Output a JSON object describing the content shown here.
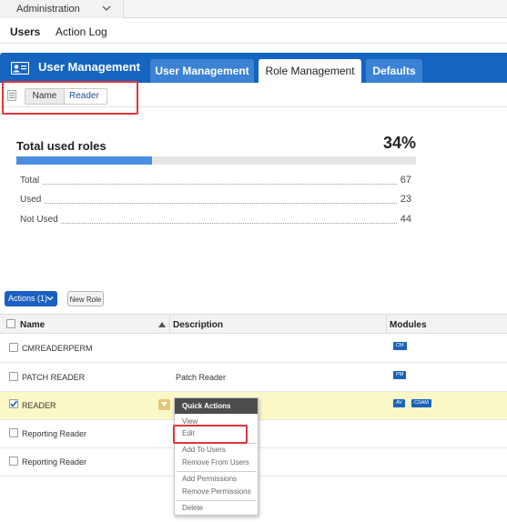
{
  "topbar": {
    "module_label": "Administration"
  },
  "subnav": {
    "items": [
      "Users",
      "Action Log"
    ]
  },
  "header": {
    "title": "User Management",
    "tabs": [
      {
        "label": "User Management",
        "active": false
      },
      {
        "label": "Role Management",
        "active": true
      },
      {
        "label": "Defaults",
        "active": false
      }
    ]
  },
  "filter": {
    "key": "Name",
    "value": "Reader"
  },
  "stats": {
    "title": "Total used roles",
    "percent_label": "34%",
    "percent_value": 0.34,
    "rows": [
      {
        "label": "Total",
        "value": "67"
      },
      {
        "label": "Used",
        "value": "23"
      },
      {
        "label": "Not Used",
        "value": "44"
      }
    ]
  },
  "toolbar": {
    "actions_label": "Actions (1)",
    "new_role_label": "New Role"
  },
  "table": {
    "columns": [
      "Name",
      "Description",
      "Modules"
    ],
    "rows": [
      {
        "name": "CMREADERPERM",
        "description": "",
        "modules": [
          "CM"
        ],
        "checked": false,
        "selected": false
      },
      {
        "name": "PATCH READER",
        "description": "Patch Reader",
        "modules": [
          "PM"
        ],
        "checked": false,
        "selected": false
      },
      {
        "name": "READER",
        "description": "",
        "modules": [
          "AV",
          "CSAM"
        ],
        "checked": true,
        "selected": true
      },
      {
        "name": "Reporting Reader",
        "description": "",
        "modules": [],
        "checked": false,
        "selected": false
      },
      {
        "name": "Reporting Reader",
        "description": "",
        "modules": [],
        "checked": false,
        "selected": false
      }
    ]
  },
  "quick_actions": {
    "title": "Quick Actions",
    "items": [
      "View",
      "Edit",
      "Add To Users",
      "Remove From Users",
      "Add Permissions",
      "Remove Permissions",
      "Delete"
    ]
  },
  "colors": {
    "brand_blue": "#1565c0",
    "highlight_red": "#e0333b",
    "selected_row": "#fbf8c8"
  }
}
